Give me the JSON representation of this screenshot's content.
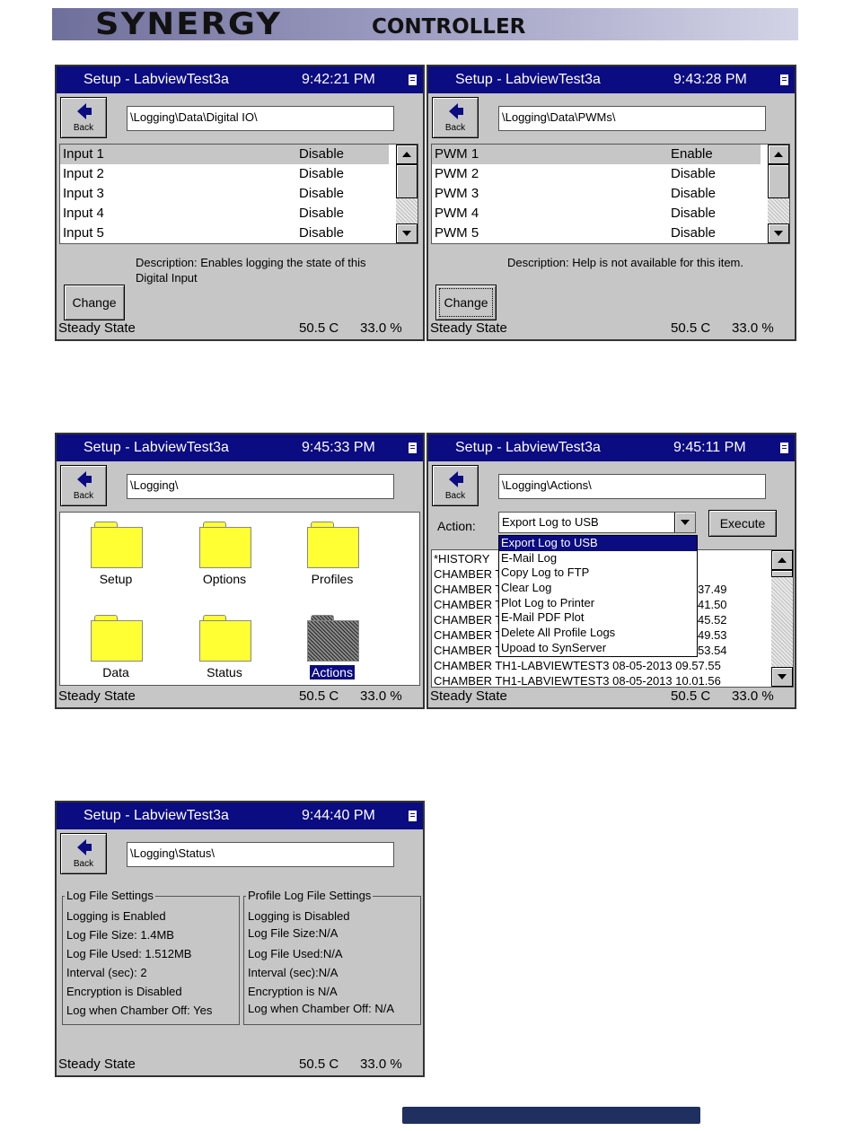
{
  "banner": {
    "brand": "SYNERGY",
    "product": "CONTROLLER"
  },
  "common": {
    "window_title": "Setup - LabviewTest3a",
    "back_label": "Back",
    "status_state": "Steady State",
    "status_temp": "50.5 C",
    "status_humidity": "33.0 %"
  },
  "screen1": {
    "time": "9:42:21 PM",
    "path": "\\Logging\\Data\\Digital IO\\",
    "items": [
      {
        "name": "Input 1",
        "value": "Disable"
      },
      {
        "name": "Input 2",
        "value": "Disable"
      },
      {
        "name": "Input 3",
        "value": "Disable"
      },
      {
        "name": "Input 4",
        "value": "Disable"
      },
      {
        "name": "Input 5",
        "value": "Disable"
      }
    ],
    "description_line1": "Description:  Enables logging the state of this",
    "description_line2": "Digital Input",
    "change_label": "Change"
  },
  "screen2": {
    "time": "9:43:28 PM",
    "path": "\\Logging\\Data\\PWMs\\",
    "items": [
      {
        "name": "PWM 1",
        "value": "Enable"
      },
      {
        "name": "PWM 2",
        "value": "Disable"
      },
      {
        "name": "PWM 3",
        "value": "Disable"
      },
      {
        "name": "PWM 4",
        "value": "Disable"
      },
      {
        "name": "PWM 5",
        "value": "Disable"
      }
    ],
    "description_line1": "Description:  Help is not available for this item.",
    "change_label": "Change"
  },
  "screen3": {
    "time": "9:45:33 PM",
    "path": "\\Logging\\",
    "folders": [
      "Setup",
      "Options",
      "Profiles",
      "Data",
      "Status",
      "Actions"
    ]
  },
  "screen4": {
    "time": "9:45:11 PM",
    "path": "\\Logging\\Actions\\",
    "action_label": "Action:",
    "action_value": "Export Log to USB",
    "execute_label": "Execute",
    "options": [
      "Export Log to USB",
      "E-Mail Log",
      "Copy Log to FTP",
      "Clear Log",
      "Plot Log to Printer",
      "E-Mail PDF Plot",
      "Delete All Profile Logs",
      "Upoad to SynServer"
    ],
    "log_lines": [
      {
        "left": "*HISTORY",
        "right": ""
      },
      {
        "left": "CHAMBER T",
        "right": ""
      },
      {
        "left": "CHAMBER T",
        "right": "37.49"
      },
      {
        "left": "CHAMBER T",
        "right": "41.50"
      },
      {
        "left": "CHAMBER T",
        "right": "45.52"
      },
      {
        "left": "CHAMBER T",
        "right": "49.53"
      },
      {
        "left": "CHAMBER T",
        "right": "53.54"
      },
      {
        "left": "CHAMBER TH1-LABVIEWTEST3 08-05-2013 09.57.55",
        "right": ""
      },
      {
        "left": "CHAMBER TH1-LABVIEWTEST3 08-05-2013 10.01.56",
        "right": ""
      }
    ]
  },
  "screen5": {
    "time": "9:44:40 PM",
    "path": "\\Logging\\Status\\",
    "log_group_title": "Log File Settings",
    "log_lines": [
      "Logging is Enabled",
      "Log File Size: 1.4MB",
      "Log File Used: 1.512MB",
      "Interval (sec): 2",
      "Encryption is Disabled",
      "Log when Chamber Off: Yes"
    ],
    "profile_group_title": "Profile Log File Settings",
    "profile_lines": [
      "Logging is Disabled",
      "Log File Size:N/A",
      "Log File Used:N/A",
      "Interval (sec):N/A",
      "Encryption is N/A",
      "Log when Chamber Off: N/A"
    ]
  }
}
